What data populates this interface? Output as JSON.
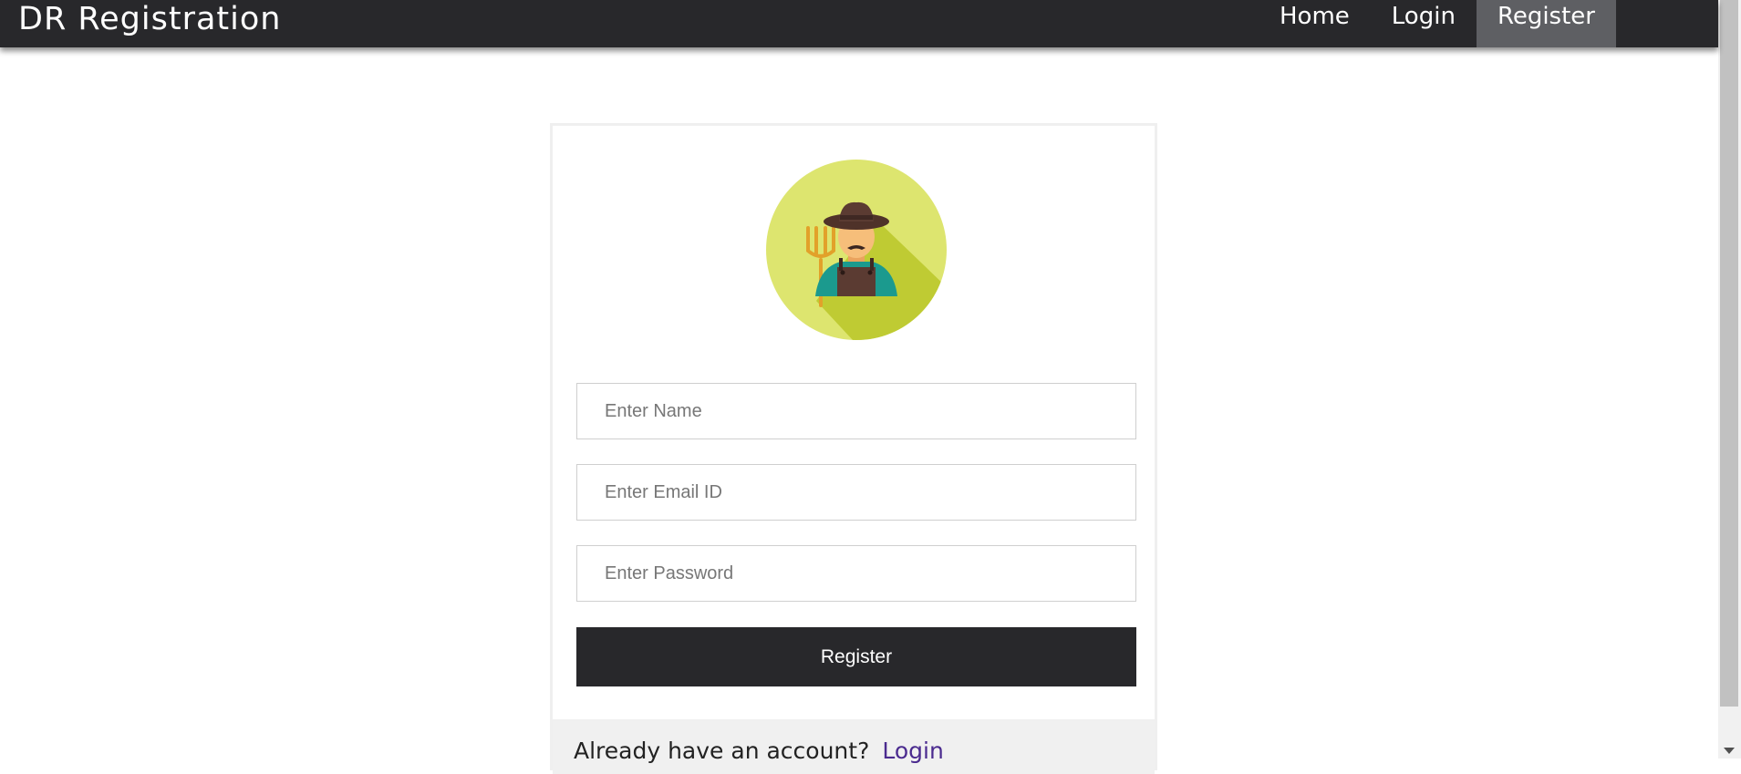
{
  "navbar": {
    "brand": "DR Registration",
    "links": [
      {
        "label": "Home"
      },
      {
        "label": "Login"
      },
      {
        "label": "Register"
      }
    ],
    "active_link": "Register"
  },
  "form": {
    "avatar_icon": "farmer-icon",
    "name_placeholder": "Enter Name",
    "email_placeholder": "Enter Email ID",
    "password_placeholder": "Enter Password",
    "submit_label": "Register",
    "footer_text": "Already have an account?",
    "footer_link": "Login"
  },
  "colors": {
    "navbar_bg": "#28282b",
    "active_tab_bg": "#5e5f63",
    "button_bg": "#28282b",
    "avatar_bg": "#dde56f",
    "link": "#4b2b8f"
  }
}
